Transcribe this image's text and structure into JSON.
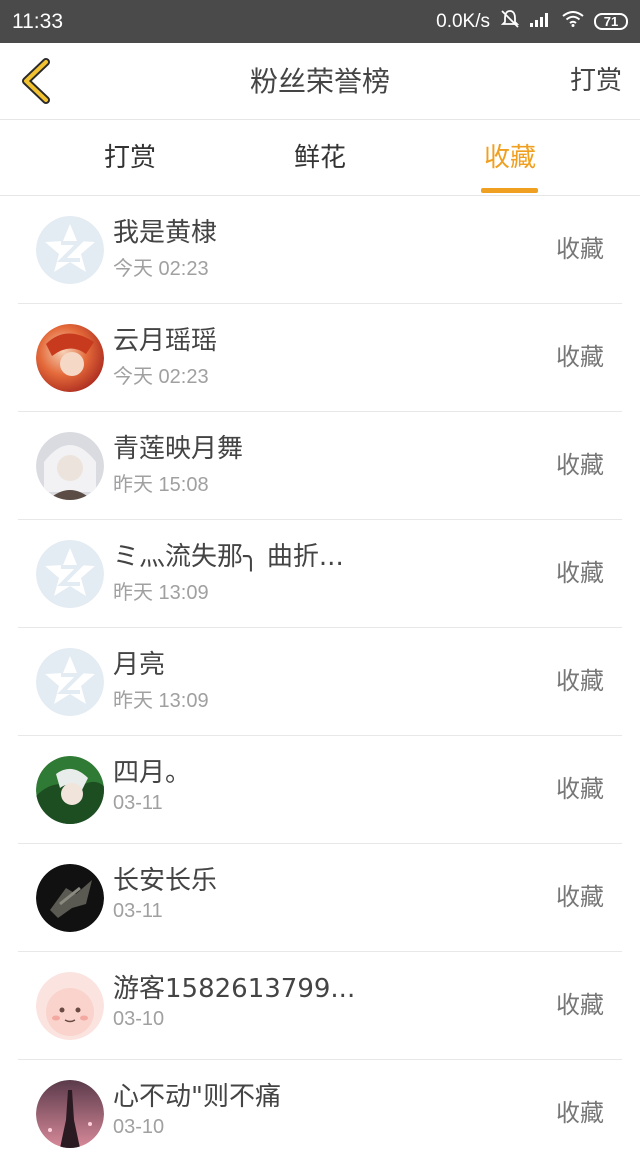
{
  "status_bar": {
    "time": "11:33",
    "net_speed": "0.0K/s",
    "battery": "71"
  },
  "header": {
    "title": "粉丝荣誉榜",
    "action": "打赏"
  },
  "tabs": [
    {
      "label": "打赏",
      "active": false
    },
    {
      "label": "鲜花",
      "active": false
    },
    {
      "label": "收藏",
      "active": true
    }
  ],
  "colors": {
    "accent": "#f0a020",
    "text": "#444444",
    "muted": "#a0a0a0"
  },
  "rows": [
    {
      "name": "我是黄棣",
      "time": "今天 02:23",
      "type": "收藏",
      "avatar": "default-avatar-icon"
    },
    {
      "name": "云月瑶瑶",
      "time": "今天 02:23",
      "type": "收藏",
      "avatar": "anime-avatar-red"
    },
    {
      "name": "青莲映月舞",
      "time": "昨天 15:08",
      "type": "收藏",
      "avatar": "anime-avatar-silver"
    },
    {
      "name": "ミ灬流失那╮ 曲折...",
      "time": "昨天 13:09",
      "type": "收藏",
      "avatar": "default-avatar-icon"
    },
    {
      "name": "月亮",
      "time": "昨天 13:09",
      "type": "收藏",
      "avatar": "default-avatar-icon"
    },
    {
      "name": "四月。",
      "time": "03-11",
      "type": "收藏",
      "avatar": "anime-avatar-green"
    },
    {
      "name": "长安长乐",
      "time": "03-11",
      "type": "收藏",
      "avatar": "dark-avatar"
    },
    {
      "name": "游客1582613799...",
      "time": "03-10",
      "type": "收藏",
      "avatar": "pink-cartoon-avatar"
    },
    {
      "name": "心不动\"则不痛",
      "time": "03-10",
      "type": "收藏",
      "avatar": "night-city-avatar"
    }
  ]
}
